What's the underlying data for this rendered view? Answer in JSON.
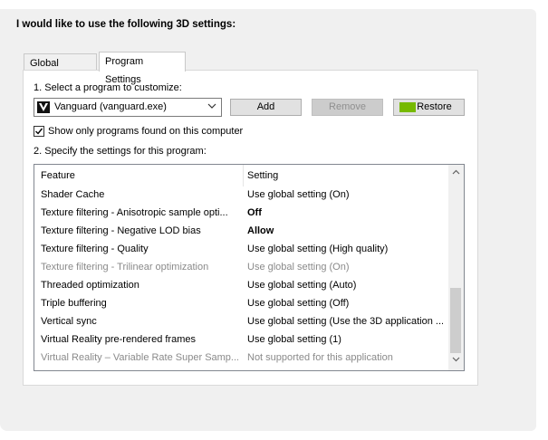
{
  "heading": "I would like to use the following 3D settings:",
  "tabs": [
    {
      "label": "Global Settings",
      "active": false
    },
    {
      "label": "Program Settings",
      "active": true
    }
  ],
  "step1_label": "1. Select a program to customize:",
  "program_select": {
    "value": "Vanguard (vanguard.exe)"
  },
  "buttons": {
    "add": "Add",
    "remove": "Remove",
    "restore": "Restore"
  },
  "show_only_checkbox": {
    "label": "Show only programs found on this computer",
    "checked": true
  },
  "step2_label": "2. Specify the settings for this program:",
  "table": {
    "headers": {
      "feature": "Feature",
      "setting": "Setting"
    },
    "rows": [
      {
        "feature": "Shader Cache",
        "setting": "Use global setting (On)"
      },
      {
        "feature": "Texture filtering - Anisotropic sample opti...",
        "setting": "Off"
      },
      {
        "feature": "Texture filtering - Negative LOD bias",
        "setting": "Allow"
      },
      {
        "feature": "Texture filtering - Quality",
        "setting": "Use global setting (High quality)"
      },
      {
        "feature": "Texture filtering - Trilinear optimization",
        "setting": "Use global setting (On)"
      },
      {
        "feature": "Threaded optimization",
        "setting": "Use global setting (Auto)"
      },
      {
        "feature": "Triple buffering",
        "setting": "Use global setting (Off)"
      },
      {
        "feature": "Vertical sync",
        "setting": "Use global setting (Use the 3D application ..."
      },
      {
        "feature": "Virtual Reality pre-rendered frames",
        "setting": "Use global setting (1)"
      },
      {
        "feature": "Virtual Reality – Variable Rate Super Samp...",
        "setting": "Not supported for this application"
      }
    ]
  },
  "colors": {
    "nvidia_green": "#76b900",
    "disabled_text": "#8a8a8a"
  }
}
